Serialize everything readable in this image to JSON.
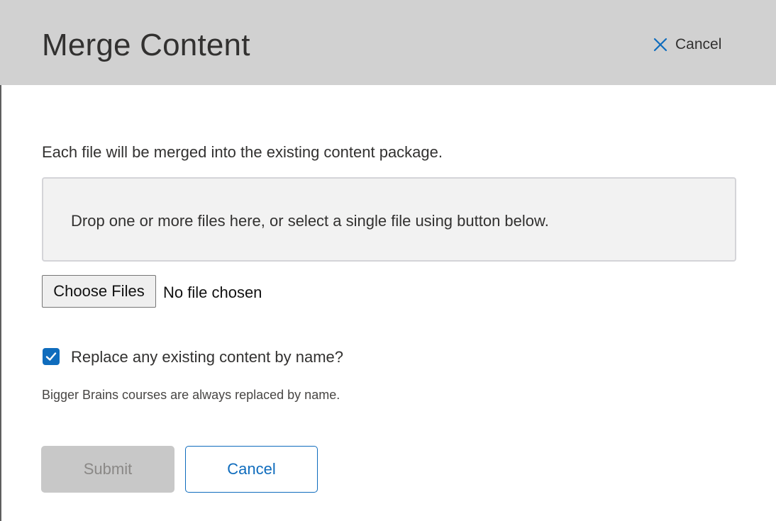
{
  "dialog": {
    "title": "Merge Content",
    "close_label": "Cancel"
  },
  "intro_text": "Each file will be merged into the existing content package.",
  "dropzone": {
    "text": "Drop one or more files here, or select a single file using button below."
  },
  "file_input": {
    "button_label": "Choose Files",
    "status": "No file chosen"
  },
  "replace_option": {
    "label": "Replace any existing content by name?",
    "checked": true
  },
  "note": "Bigger Brains courses are always replaced by name.",
  "actions": {
    "submit_label": "Submit",
    "submit_disabled": true,
    "cancel_label": "Cancel"
  },
  "icons": {
    "close": "close-x-icon",
    "checkbox": "checkmark-icon"
  },
  "colors": {
    "accent": "#0f6cbd",
    "header_bg": "#d1d1d1",
    "dropzone_bg": "#f2f2f2",
    "disabled_bg": "#c8c8c8",
    "disabled_text": "#8a8886"
  }
}
